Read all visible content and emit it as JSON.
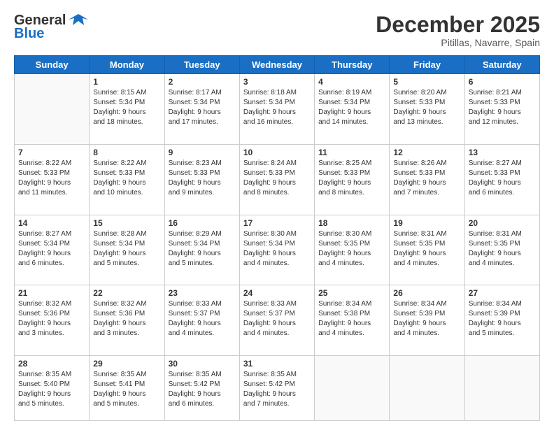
{
  "header": {
    "logo": {
      "general": "General",
      "blue": "Blue"
    },
    "title": "December 2025",
    "location": "Pitillas, Navarre, Spain"
  },
  "weekdays": [
    "Sunday",
    "Monday",
    "Tuesday",
    "Wednesday",
    "Thursday",
    "Friday",
    "Saturday"
  ],
  "weeks": [
    [
      {
        "day": "",
        "info": ""
      },
      {
        "day": "1",
        "info": "Sunrise: 8:15 AM\nSunset: 5:34 PM\nDaylight: 9 hours\nand 18 minutes."
      },
      {
        "day": "2",
        "info": "Sunrise: 8:17 AM\nSunset: 5:34 PM\nDaylight: 9 hours\nand 17 minutes."
      },
      {
        "day": "3",
        "info": "Sunrise: 8:18 AM\nSunset: 5:34 PM\nDaylight: 9 hours\nand 16 minutes."
      },
      {
        "day": "4",
        "info": "Sunrise: 8:19 AM\nSunset: 5:34 PM\nDaylight: 9 hours\nand 14 minutes."
      },
      {
        "day": "5",
        "info": "Sunrise: 8:20 AM\nSunset: 5:33 PM\nDaylight: 9 hours\nand 13 minutes."
      },
      {
        "day": "6",
        "info": "Sunrise: 8:21 AM\nSunset: 5:33 PM\nDaylight: 9 hours\nand 12 minutes."
      }
    ],
    [
      {
        "day": "7",
        "info": "Sunrise: 8:22 AM\nSunset: 5:33 PM\nDaylight: 9 hours\nand 11 minutes."
      },
      {
        "day": "8",
        "info": "Sunrise: 8:22 AM\nSunset: 5:33 PM\nDaylight: 9 hours\nand 10 minutes."
      },
      {
        "day": "9",
        "info": "Sunrise: 8:23 AM\nSunset: 5:33 PM\nDaylight: 9 hours\nand 9 minutes."
      },
      {
        "day": "10",
        "info": "Sunrise: 8:24 AM\nSunset: 5:33 PM\nDaylight: 9 hours\nand 8 minutes."
      },
      {
        "day": "11",
        "info": "Sunrise: 8:25 AM\nSunset: 5:33 PM\nDaylight: 9 hours\nand 8 minutes."
      },
      {
        "day": "12",
        "info": "Sunrise: 8:26 AM\nSunset: 5:33 PM\nDaylight: 9 hours\nand 7 minutes."
      },
      {
        "day": "13",
        "info": "Sunrise: 8:27 AM\nSunset: 5:33 PM\nDaylight: 9 hours\nand 6 minutes."
      }
    ],
    [
      {
        "day": "14",
        "info": "Sunrise: 8:27 AM\nSunset: 5:34 PM\nDaylight: 9 hours\nand 6 minutes."
      },
      {
        "day": "15",
        "info": "Sunrise: 8:28 AM\nSunset: 5:34 PM\nDaylight: 9 hours\nand 5 minutes."
      },
      {
        "day": "16",
        "info": "Sunrise: 8:29 AM\nSunset: 5:34 PM\nDaylight: 9 hours\nand 5 minutes."
      },
      {
        "day": "17",
        "info": "Sunrise: 8:30 AM\nSunset: 5:34 PM\nDaylight: 9 hours\nand 4 minutes."
      },
      {
        "day": "18",
        "info": "Sunrise: 8:30 AM\nSunset: 5:35 PM\nDaylight: 9 hours\nand 4 minutes."
      },
      {
        "day": "19",
        "info": "Sunrise: 8:31 AM\nSunset: 5:35 PM\nDaylight: 9 hours\nand 4 minutes."
      },
      {
        "day": "20",
        "info": "Sunrise: 8:31 AM\nSunset: 5:35 PM\nDaylight: 9 hours\nand 4 minutes."
      }
    ],
    [
      {
        "day": "21",
        "info": "Sunrise: 8:32 AM\nSunset: 5:36 PM\nDaylight: 9 hours\nand 3 minutes."
      },
      {
        "day": "22",
        "info": "Sunrise: 8:32 AM\nSunset: 5:36 PM\nDaylight: 9 hours\nand 3 minutes."
      },
      {
        "day": "23",
        "info": "Sunrise: 8:33 AM\nSunset: 5:37 PM\nDaylight: 9 hours\nand 4 minutes."
      },
      {
        "day": "24",
        "info": "Sunrise: 8:33 AM\nSunset: 5:37 PM\nDaylight: 9 hours\nand 4 minutes."
      },
      {
        "day": "25",
        "info": "Sunrise: 8:34 AM\nSunset: 5:38 PM\nDaylight: 9 hours\nand 4 minutes."
      },
      {
        "day": "26",
        "info": "Sunrise: 8:34 AM\nSunset: 5:39 PM\nDaylight: 9 hours\nand 4 minutes."
      },
      {
        "day": "27",
        "info": "Sunrise: 8:34 AM\nSunset: 5:39 PM\nDaylight: 9 hours\nand 5 minutes."
      }
    ],
    [
      {
        "day": "28",
        "info": "Sunrise: 8:35 AM\nSunset: 5:40 PM\nDaylight: 9 hours\nand 5 minutes."
      },
      {
        "day": "29",
        "info": "Sunrise: 8:35 AM\nSunset: 5:41 PM\nDaylight: 9 hours\nand 5 minutes."
      },
      {
        "day": "30",
        "info": "Sunrise: 8:35 AM\nSunset: 5:42 PM\nDaylight: 9 hours\nand 6 minutes."
      },
      {
        "day": "31",
        "info": "Sunrise: 8:35 AM\nSunset: 5:42 PM\nDaylight: 9 hours\nand 7 minutes."
      },
      {
        "day": "",
        "info": ""
      },
      {
        "day": "",
        "info": ""
      },
      {
        "day": "",
        "info": ""
      }
    ]
  ]
}
